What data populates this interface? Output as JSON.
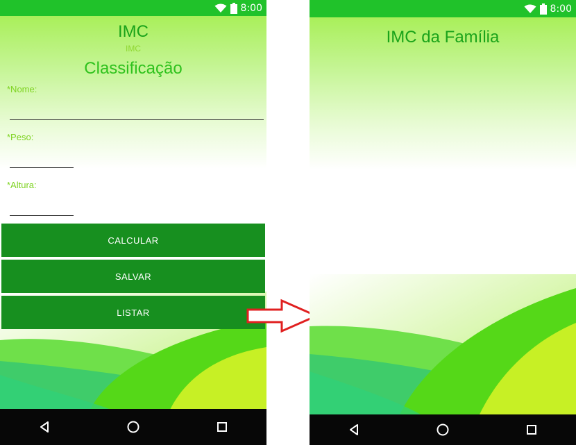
{
  "status": {
    "time": "8:00"
  },
  "left": {
    "title": "IMC",
    "subtitle": "IMC",
    "heading": "Classificação",
    "fields": [
      {
        "label": "*Nome:",
        "value": ""
      },
      {
        "label": "*Peso:",
        "value": ""
      },
      {
        "label": "*Altura:",
        "value": ""
      }
    ],
    "buttons": [
      "CALCULAR",
      "SALVAR",
      "LISTAR"
    ]
  },
  "right": {
    "title": "IMC da Família"
  },
  "icons": {
    "wifi": "wifi-icon",
    "battery": "battery-icon",
    "back": "back-icon",
    "home": "home-icon",
    "recents": "recents-icon",
    "arrow": "right-arrow-icon"
  },
  "colors": {
    "statusbar": "#20c22a",
    "button": "#178f1f",
    "title": "#1aa31a",
    "label": "#7ed321",
    "arrow": "#e02020"
  }
}
